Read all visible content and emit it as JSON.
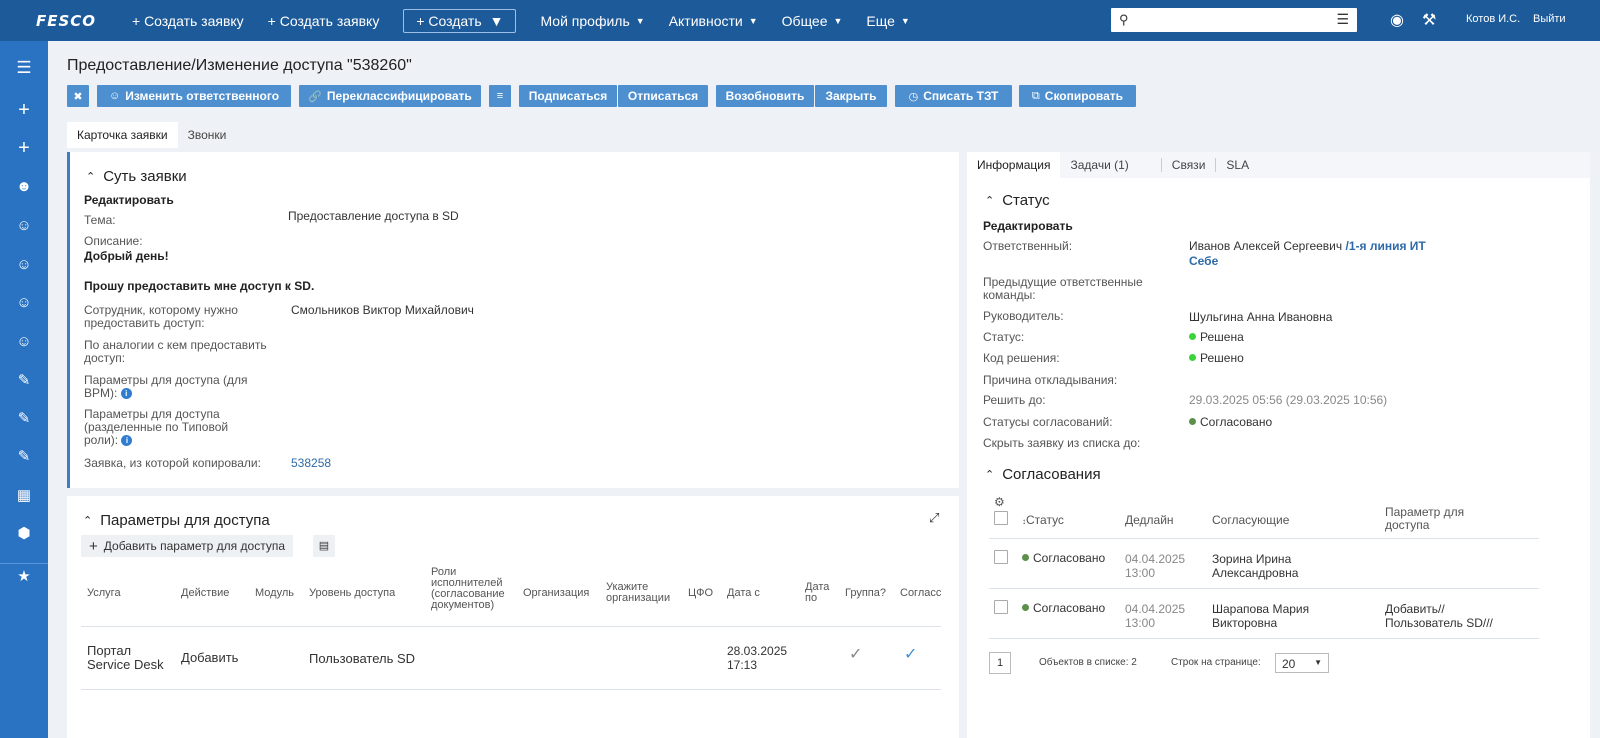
{
  "topbar": {
    "logo": "FESCO",
    "nav": [
      {
        "label": "+ Создать заявку"
      },
      {
        "label": "+ Создать заявку"
      },
      {
        "label": "Мой профиль"
      },
      {
        "label": "Активности"
      },
      {
        "label": "Общее"
      },
      {
        "label": "Еще"
      }
    ],
    "create_button": "+ Создать",
    "search_placeholder": "",
    "user": "Котов И.С.",
    "logout": "Выйти"
  },
  "page": {
    "title": "Предоставление/Изменение доступа \"538260\"",
    "toolbar": {
      "change_responsible": "Изменить ответственного",
      "reclassify": "Переклассифицировать",
      "subscribe": "Подписаться",
      "unsubscribe": "Отписаться",
      "resume": "Возобновить",
      "close": "Закрыть",
      "write_off": "Списать ТЗТ",
      "copy": "Скопировать"
    },
    "tabs": [
      "Карточка заявки",
      "Звонки"
    ]
  },
  "essence": {
    "title": "Суть заявки",
    "edit": "Редактировать",
    "topic_label": "Тема:",
    "topic_value": "Предоставление доступа в SD",
    "description_label": "Описание:",
    "description_line1": "Добрый день!",
    "description_line2": "Прошу предоставить мне доступ к SD.",
    "employee_label": "Сотрудник, которому нужно предоставить доступ:",
    "employee_value": "Смольников Виктор Михайлович",
    "analogy_label": "По аналогии с кем предоставить доступ:",
    "params_bpm_label": "Параметры для доступа (для BPM):",
    "params_role_label": "Параметры для доступа (разделенные по Типовой роли):",
    "copied_from_label": "Заявка, из которой копировали:",
    "copied_from_value": "538258"
  },
  "params": {
    "title": "Параметры для доступа",
    "add_button": "Добавить параметр для доступа",
    "columns": {
      "service": "Услуга",
      "action": "Действие",
      "module": "Модуль",
      "level": "Уровень доступа",
      "roles": "Роли исполнителей (согласование документов)",
      "org": "Организация",
      "orgs": "Укажите организации",
      "cfo": "ЦФО",
      "date_from": "Дата с",
      "date_to": "Дата по",
      "group": "Группа?",
      "agreed": "Согласс"
    },
    "row": {
      "service": "Портал Service Desk",
      "action": "Добавить",
      "level": "Пользователь SD",
      "date_from": "28.03.2025 17:13"
    }
  },
  "right": {
    "tabs": {
      "info": "Информация",
      "tasks": "Задачи (1)",
      "links": "Связи",
      "sla": "SLA"
    },
    "status": {
      "title": "Статус",
      "edit": "Редактировать",
      "responsible_label": "Ответственный:",
      "responsible_value": "Иванов Алексей Сергеевич",
      "responsible_team": "/1-я линия ИТ",
      "self_link": "Себе",
      "prev_teams_label": "Предыдущие ответственные команды:",
      "manager_label": "Руководитель:",
      "manager_value": "Шульгина Анна Ивановна",
      "status_label": "Статус:",
      "status_value": "Решена",
      "resolution_label": "Код решения:",
      "resolution_value": "Решено",
      "postpone_label": "Причина откладывания:",
      "due_label": "Решить до:",
      "due_value": "29.03.2025 05:56 (29.03.2025 10:56)",
      "approvals_status_label": "Статусы согласований:",
      "approvals_status_value": "Согласовано",
      "hide_label": "Скрыть заявку из списка до:"
    },
    "approvals": {
      "title": "Согласования",
      "columns": {
        "status": "Статус",
        "deadline": "Дедлайн",
        "approvers": "Согласующие",
        "param": "Параметр для доступа"
      },
      "rows": [
        {
          "status": "Согласовано",
          "deadline": "04.04.2025 13:00",
          "approvers": "Зорина Ирина Александровна",
          "param": ""
        },
        {
          "status": "Согласовано",
          "deadline": "04.04.2025 13:00",
          "approvers": "Шарапова Мария Викторовна",
          "param": "Добавить// Пользователь SD///"
        }
      ],
      "page": "1",
      "total_label": "Объектов в списке:",
      "total_value": "2",
      "per_page_label": "Строк на странице:",
      "per_page_value": "20"
    }
  }
}
